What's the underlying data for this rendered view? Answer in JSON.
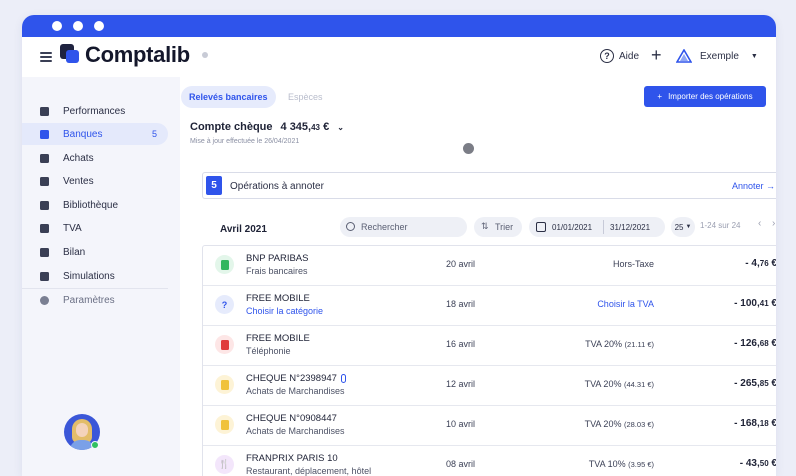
{
  "app": {
    "name": "Comptalib"
  },
  "header": {
    "help_label": "Aide",
    "plus_label": "+",
    "company_name": "Exemple"
  },
  "sidebar": {
    "items": [
      {
        "label": "Performances",
        "icon": "chart-icon"
      },
      {
        "label": "Banques",
        "icon": "bank-icon",
        "badge": "5",
        "active": true
      },
      {
        "label": "Achats",
        "icon": "file-icon"
      },
      {
        "label": "Ventes",
        "icon": "file-icon"
      },
      {
        "label": "Bibliothèque",
        "icon": "briefcase-icon"
      },
      {
        "label": "TVA",
        "icon": "file-icon"
      },
      {
        "label": "Bilan",
        "icon": "clipboard-icon"
      },
      {
        "label": "Simulations",
        "icon": "trend-icon"
      },
      {
        "label": "Paramètres",
        "icon": "gear-icon"
      }
    ]
  },
  "tabs": [
    {
      "label": "Relevés bancaires",
      "active": true
    },
    {
      "label": "Espèces",
      "active": false
    }
  ],
  "import_button": "Importer des opérations",
  "account": {
    "name": "Compte chèque",
    "amount_main": "4 345,",
    "amount_cents": "43",
    "amount_currency": " €",
    "sync_text": "Mise à jour effectuée le 26/04/2021"
  },
  "annotate": {
    "count": "5",
    "text": "Opérations à annoter",
    "link": "Annoter →"
  },
  "filters": {
    "month": "Avril 2021",
    "search_placeholder": "Rechercher",
    "sort_label": "Trier",
    "date_from": "01/01/2021",
    "date_to": "31/12/2021",
    "per_page": "25",
    "pagination": "1-24 sur 24"
  },
  "operations": [
    {
      "name": "BNP PARIBAS",
      "category": "Frais bancaires",
      "category_link": false,
      "date": "20 avril",
      "tva": "Hors-Taxe",
      "tva_detail": "",
      "tva_link": false,
      "amount_main": "- 4,",
      "amount_cents": "76",
      "icon_color": "#33b65e",
      "icon_bg": "#e3f6ea",
      "attachment": false
    },
    {
      "name": "FREE MOBILE",
      "category": "Choisir la catégorie",
      "category_link": true,
      "date": "18 avril",
      "tva": "Choisir la TVA",
      "tva_detail": "",
      "tva_link": true,
      "amount_main": "- 100,",
      "amount_cents": "41",
      "icon_color": "#2f54eb",
      "icon_bg": "#e6ebfc",
      "attachment": false
    },
    {
      "name": "FREE MOBILE",
      "category": "Téléphonie",
      "category_link": false,
      "date": "16 avril",
      "tva": "TVA 20%",
      "tva_detail": "(21.11 €)",
      "tva_link": false,
      "amount_main": "- 126,",
      "amount_cents": "68",
      "icon_color": "#e03a3a",
      "icon_bg": "#fde6e6",
      "attachment": false
    },
    {
      "name": "CHEQUE N°2398947",
      "category": "Achats de Marchandises",
      "category_link": false,
      "date": "12 avril",
      "tva": "TVA 20%",
      "tva_detail": "(44.31 €)",
      "tva_link": false,
      "amount_main": "- 265,",
      "amount_cents": "85",
      "icon_color": "#f0c23a",
      "icon_bg": "#fdf3d6",
      "attachment": true
    },
    {
      "name": "CHEQUE N°0908447",
      "category": "Achats de Marchandises",
      "category_link": false,
      "date": "10 avril",
      "tva": "TVA 20%",
      "tva_detail": "(28.03 €)",
      "tva_link": false,
      "amount_main": "- 168,",
      "amount_cents": "18",
      "icon_color": "#f0c23a",
      "icon_bg": "#fdf3d6",
      "attachment": false
    },
    {
      "name": "FRANPRIX PARIS 10",
      "category": "Restaurant, déplacement, hôtel",
      "category_link": false,
      "date": "08 avril",
      "tva": "TVA 10%",
      "tva_detail": "(3.95 €)",
      "tva_link": false,
      "amount_main": "- 43,",
      "amount_cents": "50",
      "icon_color": "#a24fd6",
      "icon_bg": "#f3e6fb",
      "attachment": false
    }
  ]
}
